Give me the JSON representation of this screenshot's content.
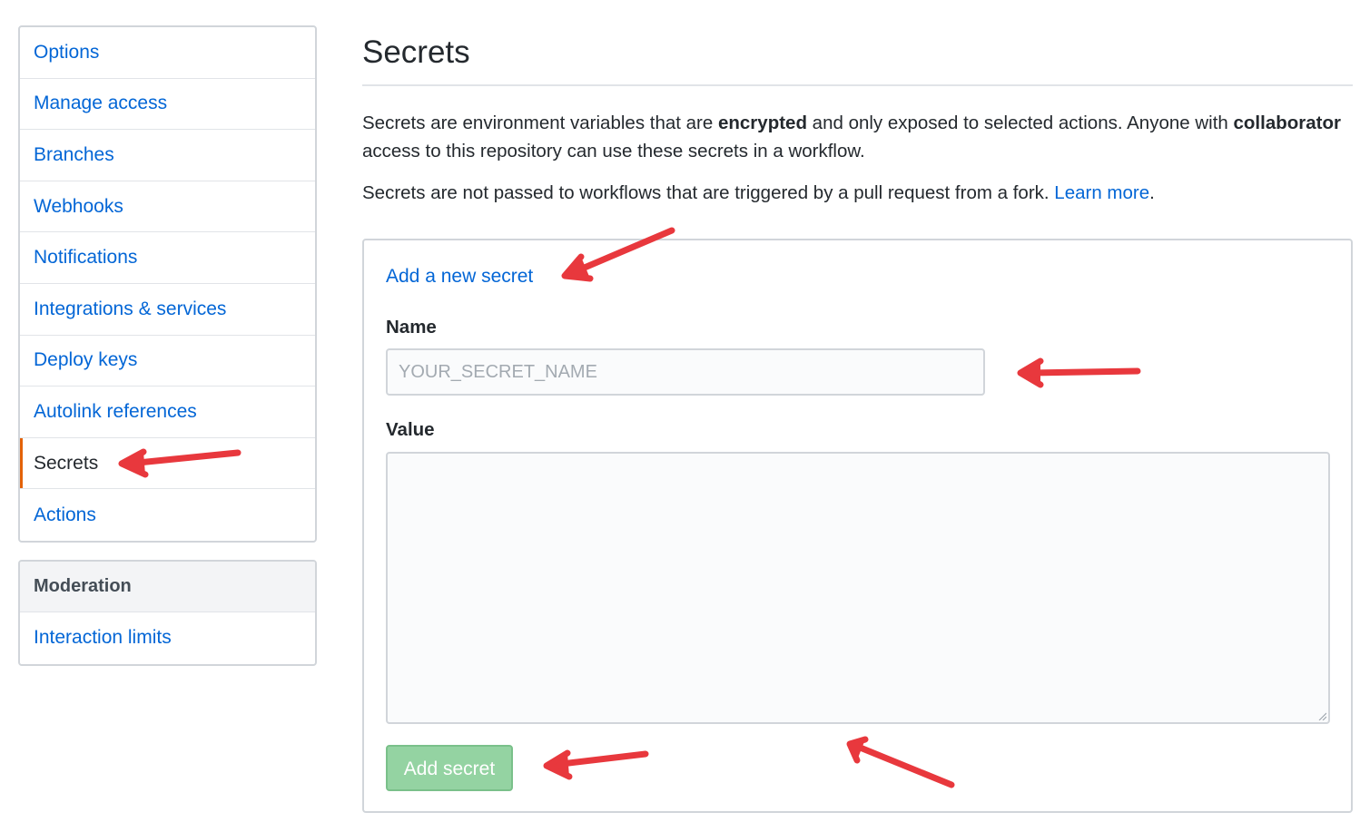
{
  "sidebar": {
    "items": [
      {
        "label": "Options"
      },
      {
        "label": "Manage access"
      },
      {
        "label": "Branches"
      },
      {
        "label": "Webhooks"
      },
      {
        "label": "Notifications"
      },
      {
        "label": "Integrations & services"
      },
      {
        "label": "Deploy keys"
      },
      {
        "label": "Autolink references"
      },
      {
        "label": "Secrets",
        "selected": true
      },
      {
        "label": "Actions"
      }
    ],
    "moderation": {
      "heading": "Moderation",
      "items": [
        {
          "label": "Interaction limits"
        }
      ]
    }
  },
  "main": {
    "title": "Secrets",
    "description_1": {
      "part1": "Secrets are environment variables that are ",
      "bold1": "encrypted",
      "part2": " and only exposed to selected actions. Anyone with ",
      "bold2": "collaborator",
      "part3": " access to this repository can use these secrets in a workflow."
    },
    "description_2": {
      "text": "Secrets are not passed to workflows that are triggered by a pull request from a fork. ",
      "link": "Learn more",
      "end": "."
    },
    "form": {
      "title": "Add a new secret",
      "name_label": "Name",
      "name_placeholder": "YOUR_SECRET_NAME",
      "name_value": "",
      "value_label": "Value",
      "value_value": "",
      "submit_label": "Add secret"
    }
  },
  "colors": {
    "link": "#0366d6",
    "selected_indicator": "#e36209",
    "button_disabled_bg": "#94d3a2",
    "annotation_arrow": "#e8383d"
  }
}
